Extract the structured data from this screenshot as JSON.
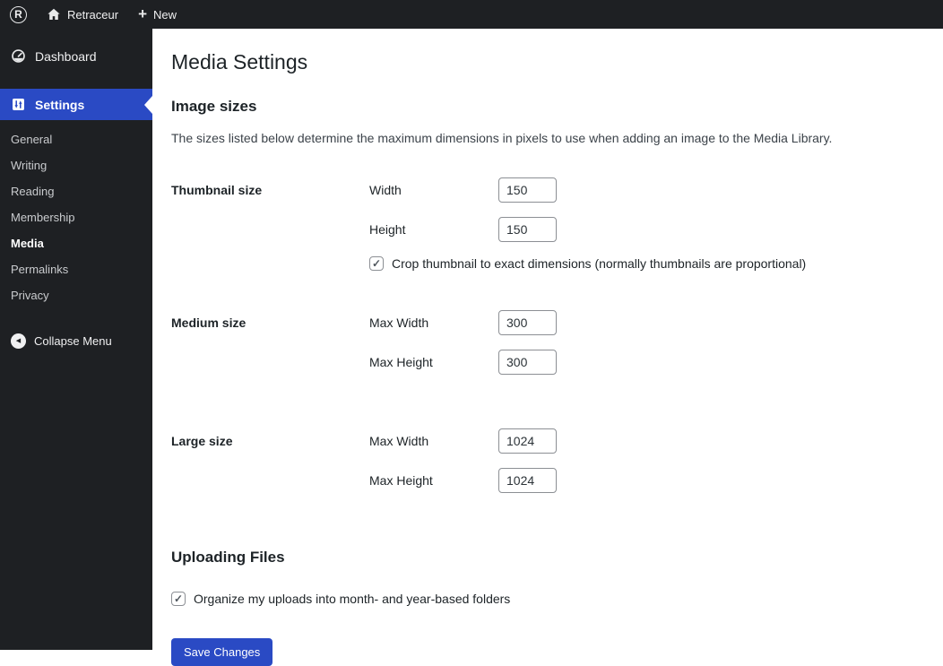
{
  "admin_bar": {
    "site_name": "Retraceur",
    "new_label": "New"
  },
  "icons": {
    "logo_letter": "R",
    "plus": "+",
    "check": "✓",
    "collapse_arrow": "◀"
  },
  "sidebar": {
    "dashboard_label": "Dashboard",
    "settings_label": "Settings",
    "submenu": [
      "General",
      "Writing",
      "Reading",
      "Membership",
      "Media",
      "Permalinks",
      "Privacy"
    ],
    "active_submenu": "Media",
    "collapse_label": "Collapse Menu"
  },
  "main": {
    "title": "Media Settings",
    "image_sizes": {
      "heading": "Image sizes",
      "description": "The sizes listed below determine the maximum dimensions in pixels to use when adding an image to the Media Library.",
      "thumbnail": {
        "label": "Thumbnail size",
        "width_label": "Width",
        "width_value": "150",
        "height_label": "Height",
        "height_value": "150",
        "crop_label": "Crop thumbnail to exact dimensions (normally thumbnails are proportional)",
        "crop_checked": true
      },
      "medium": {
        "label": "Medium size",
        "width_label": "Max Width",
        "width_value": "300",
        "height_label": "Max Height",
        "height_value": "300"
      },
      "large": {
        "label": "Large size",
        "width_label": "Max Width",
        "width_value": "1024",
        "height_label": "Max Height",
        "height_value": "1024"
      }
    },
    "uploading": {
      "heading": "Uploading Files",
      "organize_label": "Organize my uploads into month- and year-based folders",
      "organize_checked": true
    },
    "save_label": "Save Changes"
  },
  "colors": {
    "accent": "#2a4ac4",
    "adminbar_bg": "#1e2023",
    "text_dark": "#1d2327"
  }
}
